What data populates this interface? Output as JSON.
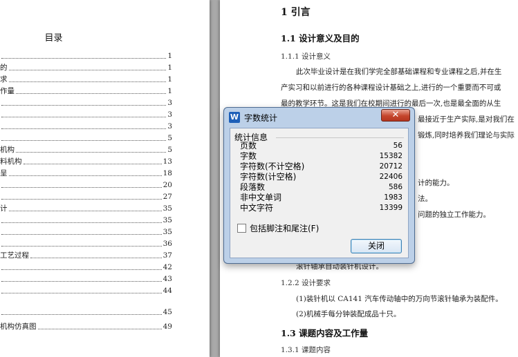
{
  "toc": {
    "title": "目录",
    "rows": [
      {
        "text": "",
        "page": "1"
      },
      {
        "text": "的",
        "page": "1"
      },
      {
        "text": "求",
        "page": "1"
      },
      {
        "text": "作量",
        "page": "1"
      },
      {
        "text": "",
        "page": "3"
      },
      {
        "text": "",
        "page": "3"
      },
      {
        "text": "",
        "page": "3"
      },
      {
        "text": "",
        "page": "5"
      },
      {
        "text": "机构",
        "page": "5"
      },
      {
        "text": "料机构",
        "page": "13"
      },
      {
        "text": "呈",
        "page": "18"
      },
      {
        "text": "",
        "page": "20"
      },
      {
        "text": "",
        "page": "27"
      },
      {
        "text": "计",
        "page": "35"
      },
      {
        "text": "",
        "page": "35"
      },
      {
        "text": "",
        "page": "35"
      },
      {
        "text": "",
        "page": "36"
      },
      {
        "text": "工艺过程",
        "page": "37"
      },
      {
        "text": "",
        "page": "42"
      },
      {
        "text": "",
        "page": "43"
      },
      {
        "text": "",
        "page": "44"
      },
      {
        "text": "",
        "page": "45"
      },
      {
        "text": "机构仿真图",
        "page": "49"
      }
    ]
  },
  "doc": {
    "h1": "1 引言",
    "h2_1": "1.1 设计意义及目的",
    "h3_1": "1.1.1 设计意义",
    "para1_l1": "此次毕业设计是在我们学完全部基础课程和专业课程之后,并在生",
    "para1_l2": "产实习和以前进行的各种课程设计基础之上,进行的一个重要而不可或",
    "para1_l3": "最的教学环节。这是我们在校期间进行的最后一次,也是最全面的从生",
    "para1_l4_tail": "最接近于生产实际,是对我们在",
    "para1_l5_tail": "锻炼,同时培养我们理论与实际",
    "frag1": "计的能力。",
    "frag2": "法。",
    "frag3": "问题的独立工作能力。",
    "frag4": "滚针轴承自动装针机设计。",
    "h3_2": "1.2.2 设计要求",
    "req1": "(1)装针机以 CA141 汽车传动轴中的万向节滚针轴承为装配件。",
    "req2": "(2)机械手每分钟装配成品十只。",
    "h2_2": "1.3 课题内容及工作量",
    "h3_3": "1.3.1 课题内容"
  },
  "dialog": {
    "title": "字数统计",
    "app_icon_letter": "W",
    "close_symbol": "✕",
    "group_heading": "统计信息",
    "stats": [
      {
        "label": "页数",
        "value": "56"
      },
      {
        "label": "字数",
        "value": "15382"
      },
      {
        "label": "字符数(不计空格)",
        "value": "20712"
      },
      {
        "label": "字符数(计空格)",
        "value": "22406"
      },
      {
        "label": "段落数",
        "value": "586"
      },
      {
        "label": "非中文单词",
        "value": "1983"
      },
      {
        "label": "中文字符",
        "value": "13399"
      }
    ],
    "include_notes_label": "包括脚注和尾注(F)",
    "include_notes_checked": false,
    "close_button_label": "关闭"
  }
}
